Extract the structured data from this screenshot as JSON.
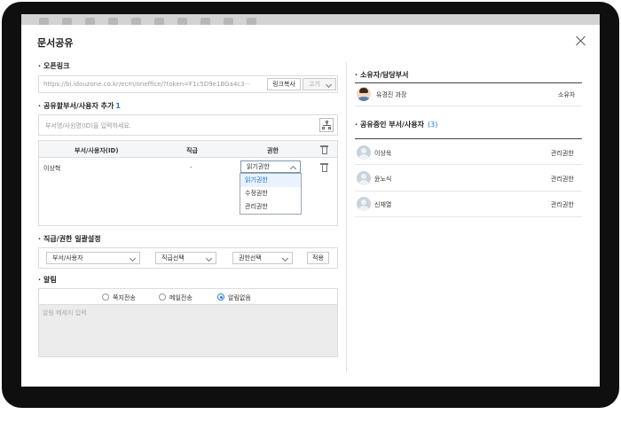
{
  "dialog": {
    "title": "문서공유"
  },
  "open_link": {
    "section_label": "오픈링크",
    "url": "https://bi.idouzone.co.kr/ecm/oneffice/?token=F1c5D9e1BGa4c3···",
    "copy_button": "링크복사",
    "close_button": "고기"
  },
  "share_add": {
    "section_label": "공유할부서/사용자 추가",
    "count": "1",
    "search_placeholder": "부서명/사원명(ID)을 입력하세요."
  },
  "share_table": {
    "columns": [
      "부서/사용자(ID)",
      "직급",
      "권한"
    ],
    "rows": [
      {
        "name": "이상혁",
        "rank": "-",
        "permission": "읽기권한"
      }
    ],
    "permission_options": [
      "읽기권한",
      "수정권한",
      "관리권한"
    ]
  },
  "bulk": {
    "section_label": "직급/권한 일괄설정",
    "dept_select": "부서/사용자",
    "rank_select": "직급선택",
    "perm_select": "권한선택",
    "apply_button": "적용"
  },
  "alarm": {
    "section_label": "알림",
    "options": [
      "쪽지전송",
      "메일전송",
      "알림없음"
    ],
    "selected": "알림없음",
    "message_placeholder": "알림 메세지 입력"
  },
  "owner": {
    "section_label": "소유자/담당부서",
    "name": "유경진 과장",
    "role": "소유자"
  },
  "sharing": {
    "section_label": "공유중인 부서/사용자",
    "count": "(3)",
    "members": [
      {
        "name": "이상욱",
        "permission": "관리권한"
      },
      {
        "name": "윤노식",
        "permission": "관리권한"
      },
      {
        "name": "신재열",
        "permission": "관리권한"
      }
    ]
  },
  "icons": {
    "close": "close-icon",
    "org_chart": "org-chart-icon",
    "trash": "trash-icon",
    "avatar": "user-avatar-icon"
  },
  "colors": {
    "accent": "#1a73d9",
    "frame": "#0f0f0f"
  }
}
